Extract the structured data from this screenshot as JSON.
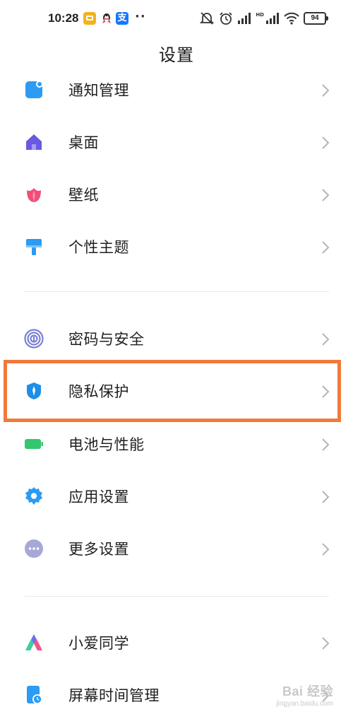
{
  "status_bar": {
    "time": "10:28",
    "alipay_glyph": "支",
    "more": "··",
    "battery": "94",
    "network_badge": "HD"
  },
  "title": "设置",
  "items": [
    {
      "label": "通知管理",
      "icon": "notification-icon",
      "color": "#2b9bf4"
    },
    {
      "label": "桌面",
      "icon": "home-icon",
      "color": "#6a5ae0"
    },
    {
      "label": "壁纸",
      "icon": "flower-icon",
      "color": "#f04e79"
    },
    {
      "label": "个性主题",
      "icon": "brush-icon",
      "color": "#2b9bf4"
    },
    {
      "label": "密码与安全",
      "icon": "fingerprint-icon",
      "color": "#7a7fd6"
    },
    {
      "label": "隐私保护",
      "icon": "shield-icon",
      "color": "#1c8fe8"
    },
    {
      "label": "电池与性能",
      "icon": "battery-icon",
      "color": "#33c66f"
    },
    {
      "label": "应用设置",
      "icon": "gear-icon",
      "color": "#2b9bf4"
    },
    {
      "label": "更多设置",
      "icon": "more-icon",
      "color": "#a6a9d8"
    },
    {
      "label": "小爱同学",
      "icon": "xiaoai-icon",
      "color": "#6f6cf4"
    },
    {
      "label": "屏幕时间管理",
      "icon": "screen-time-icon",
      "color": "#2b9bf4"
    }
  ],
  "highlight_color": "#f07a3a",
  "watermark": {
    "main": "Bai  经验",
    "sub": "jingyan.baidu.com"
  }
}
